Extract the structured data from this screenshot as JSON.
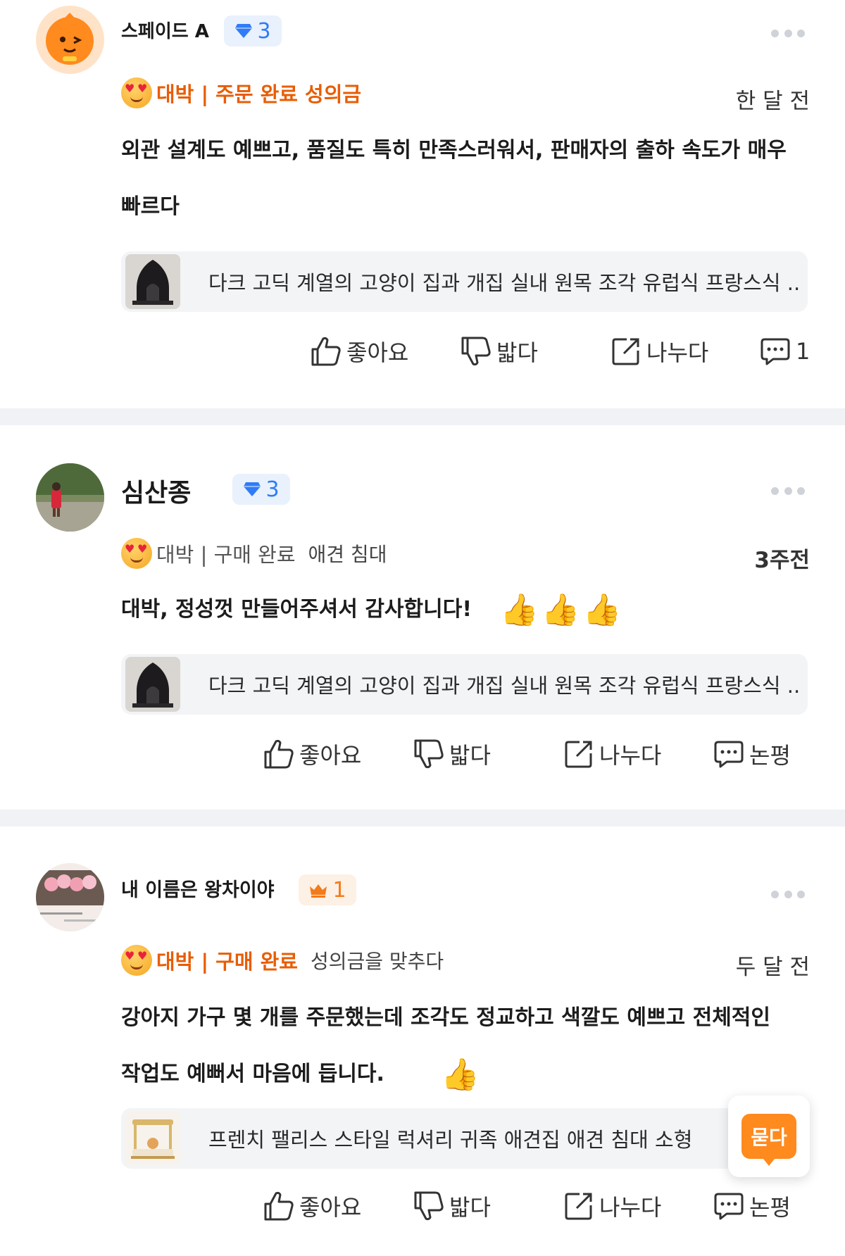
{
  "reviews": [
    {
      "username": "스페이드 A",
      "badge_level": "3",
      "rating_label": "대박 | 주문 완료 성의금",
      "variant": "",
      "time": "한 달 전",
      "body": [
        "외관 설계도 예쁘고, 품질도 특히 만족스러워서, 판매자의 출하 속도가 매우",
        "빠르다"
      ],
      "product": "다크 고딕 계열의 고양이 집과 개집 실내 원목 조각 유럽식 프랑스식 ..",
      "actions": {
        "like": "좋아요",
        "dislike": "밟다",
        "share": "나누다",
        "comment": "1"
      }
    },
    {
      "username": "심산종",
      "badge_level": "3",
      "rating_label": "대박 | 구매 완료",
      "variant": "애견 침대",
      "time": "3주전",
      "body": [
        "대박, 정성껏 만들어주셔서 감사합니다!"
      ],
      "product": "다크 고딕 계열의 고양이 집과 개집 실내 원목 조각 유럽식 프랑스식 ..",
      "actions": {
        "like": "좋아요",
        "dislike": "밟다",
        "share": "나누다",
        "comment": "논평"
      }
    },
    {
      "username": "내 이름은 왕차이야",
      "badge_level": "1",
      "rating_label": "대박 | 구매 완료",
      "variant": "성의금을 맞추다",
      "time": "두 달 전",
      "body": [
        "강아지 가구 몇 개를 주문했는데 조각도 정교하고 색깔도 예쁘고 전체적인",
        "작업도 예뻐서 마음에 듭니다."
      ],
      "product": "프렌치 팰리스 스타일 럭셔리 귀족 애견집 애견 침대 소형",
      "actions": {
        "like": "좋아요",
        "dislike": "밟다",
        "share": "나누다",
        "comment": "논평"
      }
    }
  ],
  "ask_button": "묻다",
  "icons": {
    "more": "more-dots-icon",
    "like": "thumbs-up-icon",
    "dislike": "thumbs-down-icon",
    "share": "share-icon",
    "comment": "comment-icon",
    "gem": "gem-icon",
    "crown": "crown-icon"
  },
  "colors": {
    "accent_orange": "#e85d04",
    "badge_blue": "#2f7cf6",
    "divider": "#f1f2f5"
  }
}
